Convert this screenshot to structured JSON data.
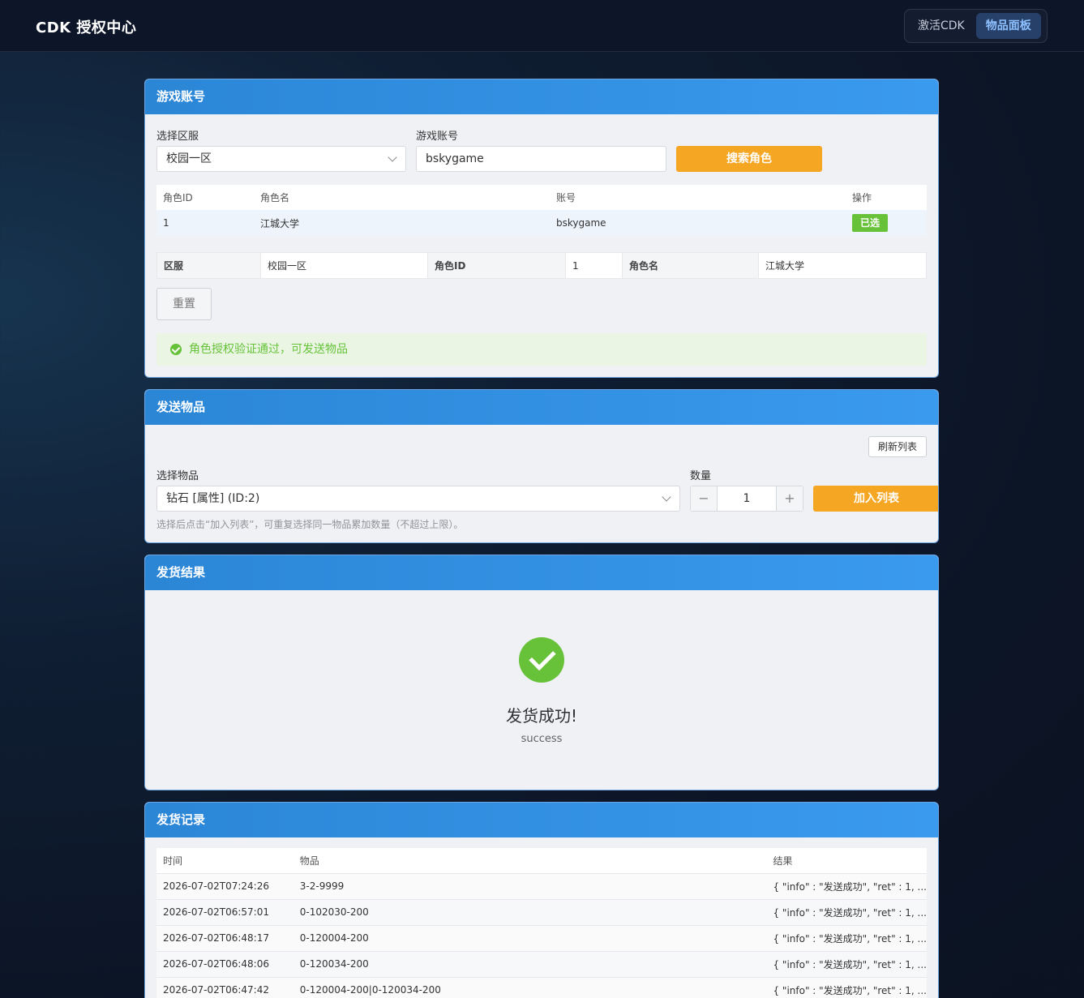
{
  "header": {
    "brand": "CDK 授权中心",
    "nav": [
      {
        "label": "激活CDK",
        "active": false
      },
      {
        "label": "物品面板",
        "active": true
      }
    ]
  },
  "account": {
    "title": "游戏账号",
    "server_label": "选择区服",
    "server_value": "校园一区",
    "account_label": "游戏账号",
    "account_value": "bskygame",
    "search_button": "搜索角色",
    "table": {
      "headers": [
        "角色ID",
        "角色名",
        "账号",
        "操作"
      ],
      "rows": [
        {
          "id": "1",
          "name": "江城大学",
          "account": "bskygame",
          "action": "已选"
        }
      ]
    },
    "selected": {
      "server_key": "区服",
      "server_val": "校园一区",
      "id_key": "角色ID",
      "id_val": "1",
      "name_key": "角色名",
      "name_val": "江城大学"
    },
    "reset_button": "重置",
    "alert": "角色授权验证通过，可发送物品"
  },
  "send": {
    "title": "发送物品",
    "refresh_button": "刷新列表",
    "item_label": "选择物品",
    "item_value": "钻石 [属性] (ID:2)",
    "qty_label": "数量",
    "qty_minus": "−",
    "qty_value": "1",
    "qty_plus": "+",
    "add_button": "加入列表",
    "hint": "选择后点击“加入列表”，可重复选择同一物品累加数量（不超过上限）。"
  },
  "result": {
    "title": "发货结果",
    "message": "发货成功!",
    "sub": "success"
  },
  "records": {
    "title": "发货记录",
    "headers": [
      "时间",
      "物品",
      "结果"
    ],
    "rows": [
      {
        "time": "2026-07-02T07:24:26",
        "item": "3-2-9999",
        "result": "{ \"info\" : \"发送成功\", \"ret\" : 1, ..."
      },
      {
        "time": "2026-07-02T06:57:01",
        "item": "0-102030-200",
        "result": "{ \"info\" : \"发送成功\", \"ret\" : 1, ..."
      },
      {
        "time": "2026-07-02T06:48:17",
        "item": "0-120004-200",
        "result": "{ \"info\" : \"发送成功\", \"ret\" : 1, ..."
      },
      {
        "time": "2026-07-02T06:48:06",
        "item": "0-120034-200",
        "result": "{ \"info\" : \"发送成功\", \"ret\" : 1, ..."
      },
      {
        "time": "2026-07-02T06:47:42",
        "item": "0-120004-200|0-120034-200",
        "result": "{ \"info\" : \"发送成功\", \"ret\" : 1, ..."
      }
    ]
  }
}
